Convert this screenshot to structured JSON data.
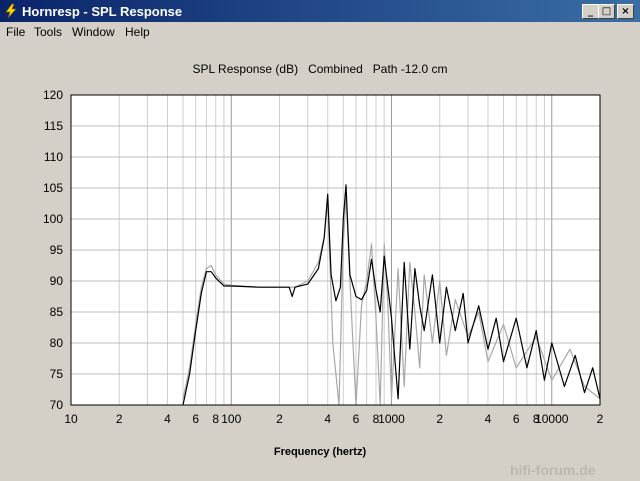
{
  "window": {
    "title": "Hornresp - SPL Response",
    "icon": "lightning-icon",
    "buttons": {
      "minimize": "_",
      "maximize": "□",
      "close": "×"
    }
  },
  "menu": [
    "File",
    "Tools",
    "Window",
    "Help"
  ],
  "watermark": "hifi-forum.de",
  "chart_data": {
    "type": "line",
    "title": "SPL Response (dB)   Combined   Path -12.0 cm",
    "xlabel": "Frequency (hertz)",
    "ylabel": "",
    "xscale": "log",
    "xlim": [
      10,
      20000
    ],
    "ylim": [
      70,
      120
    ],
    "grid": true,
    "x_tick_labels": [
      "10",
      "2",
      "4",
      "6",
      "8",
      "100",
      "2",
      "4",
      "6",
      "8",
      "1000",
      "2",
      "4",
      "6",
      "8",
      "10000",
      "2"
    ],
    "y_tick_labels": [
      "120",
      "115",
      "110",
      "105",
      "100",
      "95",
      "90",
      "85",
      "80",
      "75",
      "70"
    ],
    "series": [
      {
        "color": "#000000",
        "x": [
          50,
          55,
          60,
          65,
          70,
          75,
          80,
          90,
          100,
          150,
          200,
          230,
          240,
          250,
          300,
          350,
          380,
          400,
          420,
          450,
          480,
          500,
          520,
          550,
          600,
          650,
          700,
          750,
          800,
          850,
          900,
          950,
          1000,
          1100,
          1200,
          1300,
          1400,
          1500,
          1600,
          1800,
          2000,
          2200,
          2500,
          2800,
          3000,
          3500,
          4000,
          4500,
          5000,
          6000,
          7000,
          8000,
          9000,
          10000,
          12000,
          14000,
          16000,
          18000,
          20000
        ],
        "y": [
          70,
          75,
          82,
          88,
          91.5,
          91.5,
          90.5,
          89.2,
          89.2,
          89,
          89,
          89,
          87.5,
          89,
          89.5,
          92,
          97,
          104,
          91,
          86.8,
          89,
          100,
          105.5,
          91,
          87.5,
          87,
          88.5,
          93.5,
          88.5,
          85,
          94,
          89,
          84,
          71,
          93,
          79,
          92,
          86,
          82,
          91,
          80,
          89,
          82,
          88,
          80,
          86,
          79,
          84,
          77,
          84,
          76,
          82,
          74,
          80,
          73,
          78,
          72,
          76,
          71
        ]
      },
      {
        "color": "#a8a8a8",
        "x": [
          50,
          55,
          60,
          65,
          70,
          75,
          80,
          90,
          100,
          150,
          200,
          250,
          300,
          350,
          380,
          400,
          430,
          470,
          500,
          520,
          550,
          600,
          650,
          700,
          750,
          800,
          850,
          900,
          950,
          1000,
          1100,
          1200,
          1300,
          1400,
          1500,
          1600,
          1800,
          2000,
          2200,
          2500,
          3000,
          3500,
          4000,
          5000,
          6000,
          8000,
          10000,
          13000,
          16000,
          20000
        ],
        "y": [
          71,
          76,
          83,
          89,
          92,
          92.5,
          91,
          89.5,
          89.3,
          89,
          89,
          89,
          90,
          93,
          97,
          103,
          80,
          70,
          96,
          104,
          90,
          70,
          86,
          90,
          96,
          84,
          70,
          96,
          86,
          71,
          92,
          73,
          93,
          85,
          76,
          91,
          80,
          90,
          78,
          87,
          81,
          85,
          77,
          83,
          76,
          81,
          74,
          79,
          73,
          71
        ]
      }
    ]
  }
}
